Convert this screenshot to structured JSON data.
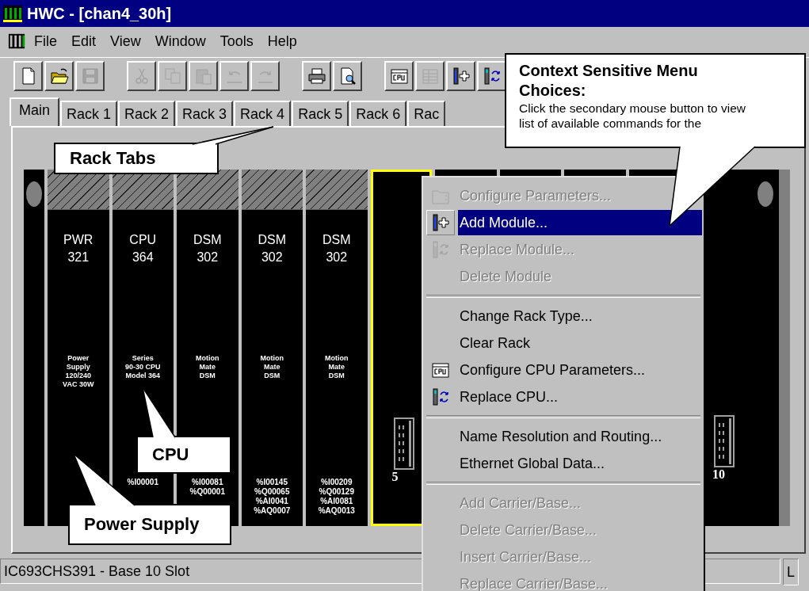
{
  "window": {
    "title": "HWC - [chan4_30h]"
  },
  "menu_bar": [
    "File",
    "Edit",
    "View",
    "Window",
    "Tools",
    "Help"
  ],
  "toolbar": [
    {
      "kind": "button",
      "disabled": false
    },
    {
      "kind": "button",
      "disabled": false
    },
    {
      "kind": "button",
      "disabled": true
    },
    {
      "kind": "separator"
    },
    {
      "kind": "button",
      "disabled": true
    },
    {
      "kind": "button",
      "disabled": true
    },
    {
      "kind": "button",
      "disabled": true
    },
    {
      "kind": "button",
      "disabled": true
    },
    {
      "kind": "button",
      "disabled": true
    },
    {
      "kind": "separator"
    },
    {
      "kind": "button",
      "disabled": false
    },
    {
      "kind": "button",
      "disabled": false
    },
    {
      "kind": "separator"
    },
    {
      "kind": "button",
      "disabled": false
    },
    {
      "kind": "button",
      "disabled": true
    },
    {
      "kind": "button",
      "disabled": false
    },
    {
      "kind": "button",
      "disabled": false
    }
  ],
  "tabs": [
    {
      "label": "Main",
      "selected": true
    },
    {
      "label": "Rack 1",
      "selected": false
    },
    {
      "label": "Rack 2",
      "selected": false
    },
    {
      "label": "Rack 3",
      "selected": false
    },
    {
      "label": "Rack 4",
      "selected": false
    },
    {
      "label": "Rack 5",
      "selected": false
    },
    {
      "label": "Rack 6",
      "selected": false
    },
    {
      "label": "Rac",
      "selected": false
    }
  ],
  "rack": {
    "slots": [
      {
        "kind": "module",
        "selected": false,
        "type": "PWR",
        "catalog": "321",
        "description": [
          "Power",
          "Supply",
          "120/240",
          "VAC 30W"
        ]
      },
      {
        "kind": "module",
        "selected": false,
        "type": "CPU",
        "catalog": "364",
        "description": [
          "Series",
          "90-30 CPU",
          "Model 364"
        ],
        "addresses": [
          "%I00001"
        ]
      },
      {
        "kind": "module",
        "selected": false,
        "type": "DSM",
        "catalog": "302",
        "description": [
          "Motion",
          "Mate",
          "DSM"
        ],
        "addresses": [
          "%I00081",
          "%Q00001"
        ]
      },
      {
        "kind": "module",
        "selected": false,
        "type": "DSM",
        "catalog": "302",
        "description": [
          "Motion",
          "Mate",
          "DSM"
        ],
        "addresses": [
          "%I00145",
          "%Q00065",
          "%AI0041",
          "%AQ0007"
        ]
      },
      {
        "kind": "module",
        "selected": false,
        "type": "DSM",
        "catalog": "302",
        "description": [
          "Motion",
          "Mate",
          "DSM"
        ],
        "addresses": [
          "%I00209",
          "%Q00129",
          "%AI0081",
          "%AQ0013"
        ]
      },
      {
        "kind": "empty",
        "selected": true,
        "number": "5"
      },
      {
        "kind": "empty",
        "selected": false
      },
      {
        "kind": "empty",
        "selected": false
      },
      {
        "kind": "empty",
        "selected": false
      },
      {
        "kind": "empty",
        "selected": false
      },
      {
        "kind": "empty",
        "selected": false,
        "number": "10"
      }
    ]
  },
  "context_menu": [
    {
      "kind": "item",
      "label": "Configure Parameters...",
      "disabled": true,
      "selected": false
    },
    {
      "kind": "item",
      "label": "Add Module...",
      "disabled": false,
      "selected": true
    },
    {
      "kind": "item",
      "label": "Replace Module...",
      "disabled": true,
      "selected": false
    },
    {
      "kind": "item",
      "label": "Delete Module",
      "disabled": true,
      "selected": false
    },
    {
      "kind": "separator"
    },
    {
      "kind": "item",
      "label": "Change Rack Type...",
      "disabled": false,
      "selected": false
    },
    {
      "kind": "item",
      "label": "Clear Rack",
      "disabled": false,
      "selected": false
    },
    {
      "kind": "item",
      "label": "Configure CPU Parameters...",
      "disabled": false,
      "selected": false
    },
    {
      "kind": "item",
      "label": "Replace CPU...",
      "disabled": false,
      "selected": false
    },
    {
      "kind": "separator"
    },
    {
      "kind": "item",
      "label": "Name Resolution and Routing...",
      "disabled": false,
      "selected": false
    },
    {
      "kind": "item",
      "label": "Ethernet Global Data...",
      "disabled": false,
      "selected": false
    },
    {
      "kind": "separator"
    },
    {
      "kind": "item",
      "label": "Add Carrier/Base...",
      "disabled": true,
      "selected": false
    },
    {
      "kind": "item",
      "label": "Delete Carrier/Base...",
      "disabled": true,
      "selected": false
    },
    {
      "kind": "item",
      "label": "Insert Carrier/Base...",
      "disabled": true,
      "selected": false
    },
    {
      "kind": "item",
      "label": "Replace Carrier/Base...",
      "disabled": true,
      "selected": false
    }
  ],
  "status_bar": [
    "IC693CHS391 - Base 10 Slot",
    "L"
  ],
  "callouts": [
    {
      "text": "Rack Tabs"
    },
    {
      "text": "CPU"
    },
    {
      "text": "Power Supply"
    },
    {
      "title": "Context Sensitive Menu Choices:",
      "text": "Click the secondary mouse button to view list of available commands for the"
    }
  ]
}
